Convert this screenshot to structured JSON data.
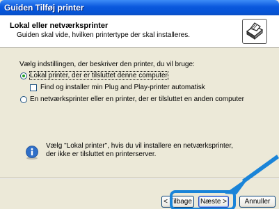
{
  "window": {
    "title": "Guiden Tilføj printer"
  },
  "header": {
    "title": "Lokal eller netværksprinter",
    "subtitle": "Guiden skal vide, hvilken printertype der skal installeres."
  },
  "content": {
    "intro": "Vælg indstillingen, der beskriver den printer, du vil bruge:",
    "option_local": "Lokal printer, der er tilsluttet denne computer",
    "option_local_selected": true,
    "checkbox_plug_and_play": "Find og installer min Plug and Play-printer automatisk",
    "checkbox_checked": false,
    "option_network": "En netværksprinter eller en printer, der er tilsluttet en anden computer",
    "info_line1": "Vælg \"Lokal printer\", hvis du vil installere en netværksprinter,",
    "info_line2": "der ikke er tilsluttet en printerserver."
  },
  "buttons": {
    "back": "< Tilbage",
    "next": "Næste >",
    "cancel": "Annuller"
  },
  "colors": {
    "titlebar": "#0a58dd",
    "highlight": "#1a84d8",
    "arrow": "#1a84d8",
    "radio_dot": "#21a121"
  },
  "icons": {
    "header": "printer-icon",
    "info": "info-icon",
    "annotation": "pointer-arrow-icon"
  }
}
